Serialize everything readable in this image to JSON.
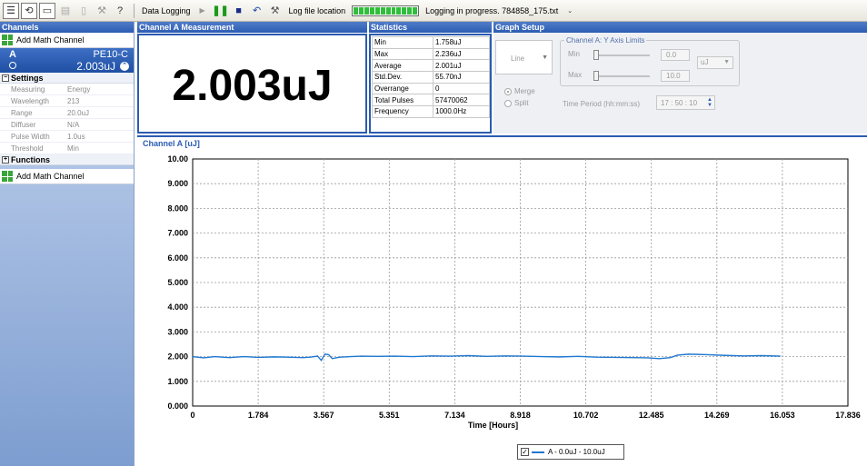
{
  "toolbar": {
    "icons": [
      "channels-icon",
      "refresh-icon",
      "window-icon",
      "display-icon",
      "info-icon",
      "tool-icon",
      "help-icon"
    ],
    "data_logging_label": "Data Logging",
    "log_file_label": "Log file location",
    "status_text": "Logging in progress. 784858_175.txt",
    "progress_fraction": 1.0
  },
  "sidebar": {
    "title": "Channels",
    "add_math_label": "Add Math Channel",
    "channel": {
      "letter": "A",
      "model": "PE10-C",
      "value": "2.003uJ"
    },
    "settings_title": "Settings",
    "settings": [
      {
        "label": "Measuring",
        "value": "Energy"
      },
      {
        "label": "Wavelength",
        "value": "213"
      },
      {
        "label": "Range",
        "value": "20.0uJ"
      },
      {
        "label": "Diffuser",
        "value": "N/A"
      },
      {
        "label": "Pulse Width",
        "value": "1.0us"
      },
      {
        "label": "Threshold",
        "value": "Min"
      }
    ],
    "functions_title": "Functions",
    "add_math_label_2": "Add Math Channel"
  },
  "measurement": {
    "title": "Channel A Measurement",
    "value": "2.003uJ"
  },
  "statistics": {
    "title": "Statistics",
    "rows": [
      {
        "label": "Min",
        "value": "1.758uJ"
      },
      {
        "label": "Max",
        "value": "2.236uJ"
      },
      {
        "label": "Average",
        "value": "2.001uJ"
      },
      {
        "label": "Std.Dev.",
        "value": "55.70nJ"
      },
      {
        "label": "Overrange",
        "value": "0"
      },
      {
        "label": "Total Pulses",
        "value": "57470062"
      },
      {
        "label": "Frequency",
        "value": "1000.0Hz"
      }
    ]
  },
  "graph_setup": {
    "title": "Graph Setup",
    "graph_type": "Line",
    "merge_label": "Merge",
    "split_label": "Split",
    "merge_selected": true,
    "ylimits_title": "Channel A: Y Axis Limits",
    "min_label": "Min",
    "min_value": "0.0",
    "max_label": "Max",
    "max_value": "10.0",
    "unit": "uJ",
    "time_period_label": "Time Period (hh:mm:ss)",
    "time_period_value": "17 : 50 : 10"
  },
  "chart_data": {
    "type": "line",
    "title": "Channel A [uJ]",
    "xlabel": "Time [Hours]",
    "ylabel": "",
    "xlim": [
      0,
      17.836
    ],
    "ylim": [
      0,
      10
    ],
    "x_ticks": [
      "0",
      "1.784",
      "3.567",
      "5.351",
      "7.134",
      "8.918",
      "10.702",
      "12.485",
      "14.269",
      "16.053",
      "17.836"
    ],
    "y_ticks": [
      "0.000",
      "1.000",
      "2.000",
      "3.000",
      "4.000",
      "5.000",
      "6.000",
      "7.000",
      "8.000",
      "9.000",
      "10.00"
    ],
    "grid": true,
    "legend_position": "bottom-center",
    "series": [
      {
        "name": "A - 0.0uJ - 10.0uJ",
        "color": "#1f78d1",
        "x": [
          0,
          0.3,
          0.6,
          1.0,
          1.4,
          1.8,
          2.2,
          2.6,
          3.0,
          3.2,
          3.4,
          3.5,
          3.6,
          3.7,
          3.8,
          4.0,
          4.3,
          4.6,
          5.0,
          5.5,
          6.0,
          6.5,
          7.0,
          7.5,
          8.0,
          8.5,
          9.0,
          9.5,
          10.0,
          10.5,
          11.0,
          11.5,
          12.0,
          12.4,
          12.7,
          13.0,
          13.2,
          13.5,
          14.0,
          14.5,
          15.0,
          15.5,
          16.0
        ],
        "values": [
          2.0,
          1.95,
          2.0,
          1.96,
          2.0,
          1.97,
          1.99,
          1.98,
          1.96,
          1.98,
          2.02,
          1.85,
          2.1,
          2.08,
          1.92,
          1.98,
          2.0,
          2.02,
          2.01,
          2.02,
          2.0,
          2.03,
          2.02,
          2.04,
          2.01,
          2.03,
          2.02,
          2.0,
          1.99,
          2.01,
          1.98,
          1.97,
          1.96,
          1.95,
          1.92,
          1.96,
          2.06,
          2.1,
          2.08,
          2.05,
          2.03,
          2.04,
          2.02
        ]
      }
    ]
  }
}
